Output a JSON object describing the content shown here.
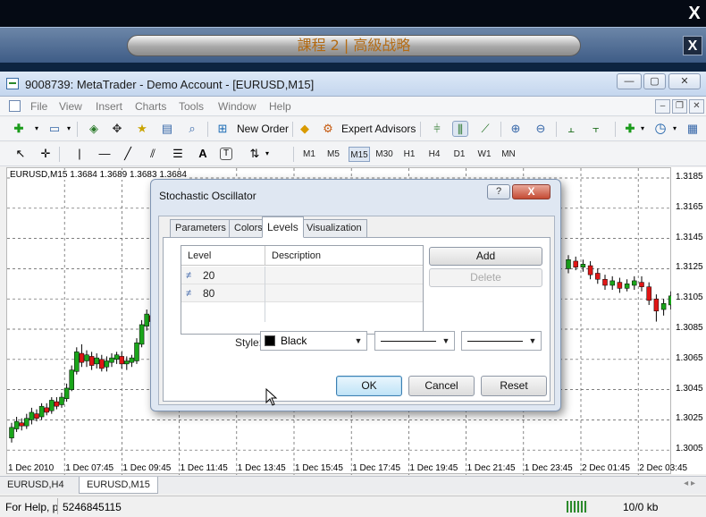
{
  "player": {
    "banner_title": "課程 2 | 高級战略",
    "close_label": "X",
    "outer_close_label": "X"
  },
  "window": {
    "title": "9008739: MetaTrader - Demo Account - [EURUSD,M15]"
  },
  "menu": [
    "File",
    "View",
    "Insert",
    "Charts",
    "Tools",
    "Window",
    "Help"
  ],
  "toolbar": {
    "new_order_label": "New Order",
    "expert_advisors_label": "Expert Advisors",
    "timeframes": [
      "M1",
      "M5",
      "M15",
      "M30",
      "H1",
      "H4",
      "D1",
      "W1",
      "MN"
    ],
    "active_timeframe": "M15",
    "text_tool_label": "A"
  },
  "chart": {
    "label": "EURUSD,M15  1.3684 1.3689 1.3683 1.3684",
    "price_ticks": [
      "1.3185",
      "1.3165",
      "1.3145",
      "1.3125",
      "1.3105",
      "1.3085",
      "1.3065",
      "1.3045",
      "1.3025",
      "1.3005"
    ],
    "time_ticks": [
      "1 Dec 2010",
      "1 Dec 07:45",
      "1 Dec 09:45",
      "1 Dec 11:45",
      "1 Dec 13:45",
      "1 Dec 15:45",
      "1 Dec 17:45",
      "1 Dec 19:45",
      "1 Dec 21:45",
      "1 Dec 23:45",
      "2 Dec 01:45",
      "2 Dec 03:45"
    ],
    "colors": {
      "bull": "#1aa51a",
      "bear": "#e01616",
      "grid": "#555555"
    }
  },
  "tabs": [
    "EURUSD,H4",
    "EURUSD,M15"
  ],
  "active_tab": "EURUSD,M15",
  "status": {
    "help_text": "For Help, p",
    "number": "5246845115",
    "traffic": "10/0 kb"
  },
  "dialog": {
    "title": "Stochastic Oscillator",
    "help_label": "?",
    "close_label": "X",
    "tabs": [
      "Parameters",
      "Colors",
      "Levels",
      "Visualization"
    ],
    "active_tab": "Levels",
    "columns": {
      "level": "Level",
      "description": "Description"
    },
    "levels": [
      {
        "value": "20",
        "description": ""
      },
      {
        "value": "80",
        "description": ""
      }
    ],
    "add_label": "Add",
    "delete_label": "Delete",
    "style_label": "Style:",
    "style_value": "Black",
    "style_color": "#000000",
    "ok_label": "OK",
    "cancel_label": "Cancel",
    "reset_label": "Reset"
  }
}
